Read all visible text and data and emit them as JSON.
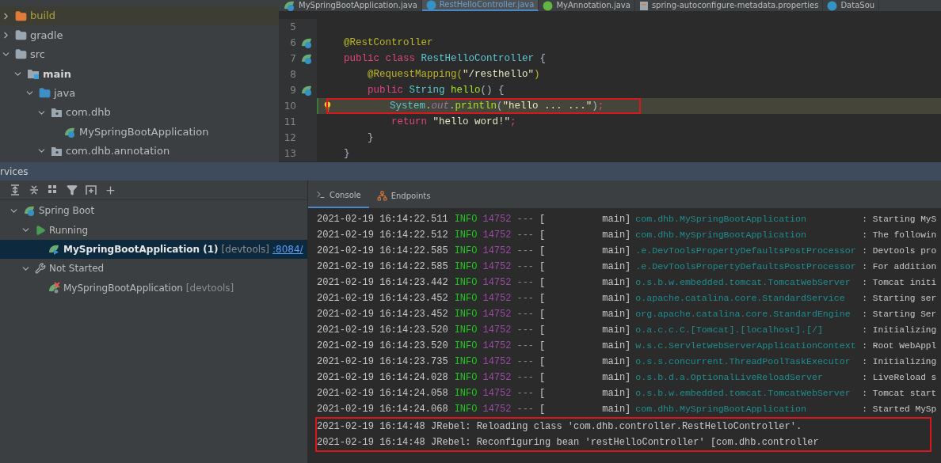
{
  "editor_tabs": [
    {
      "label": "MySpringBootApplication.java",
      "kind": "spring",
      "selected": false
    },
    {
      "label": "RestHelloController.java",
      "kind": "class",
      "selected": true
    },
    {
      "label": "MyAnnotation.java",
      "kind": "annotation",
      "selected": false
    },
    {
      "label": "spring-autoconfigure-metadata.properties",
      "kind": "properties",
      "selected": false
    },
    {
      "label": "DataSou",
      "kind": "class",
      "selected": false
    }
  ],
  "project_tree": [
    {
      "label": "build",
      "kind": "folder-excluded",
      "expanded": false,
      "selected": true
    },
    {
      "label": "gradle",
      "kind": "folder",
      "expanded": false,
      "selected": false
    },
    {
      "label": "src",
      "kind": "folder",
      "expanded": true,
      "selected": false,
      "children": [
        {
          "label": "main",
          "kind": "folder-source",
          "expanded": true,
          "selected": false,
          "children": [
            {
              "label": "java",
              "kind": "folder-java",
              "expanded": true,
              "selected": false,
              "children": [
                {
                  "label": "com.dhb",
                  "kind": "package",
                  "expanded": true,
                  "selected": false,
                  "children": [
                    {
                      "label": "MySpringBootApplication",
                      "kind": "spring",
                      "selected": false
                    }
                  ]
                },
                {
                  "label": "com.dhb.annotation",
                  "kind": "package",
                  "expanded": true,
                  "selected": false
                }
              ]
            }
          ]
        }
      ]
    }
  ],
  "code_lines": [
    {
      "number": "5",
      "kind": "plain",
      "current": false,
      "boxed": false
    },
    {
      "number": "6",
      "kind": "bean",
      "current": false,
      "boxed": false,
      "tokens": [
        {
          "kind": "annotation",
          "text": "@RestController"
        }
      ]
    },
    {
      "number": "7",
      "kind": "bean",
      "current": false,
      "boxed": false,
      "tokens": [
        {
          "kind": "keyword",
          "text": "public class "
        },
        {
          "kind": "type",
          "text": "RestHelloController"
        },
        {
          "kind": "plain",
          "text": " {"
        }
      ]
    },
    {
      "number": "8",
      "kind": "plain",
      "current": false,
      "boxed": false,
      "tokens": [
        {
          "kind": "annotation",
          "text": "    @RequestMapping("
        },
        {
          "kind": "string",
          "text": "\"/resthello\""
        },
        {
          "kind": "annotation",
          "text": ")"
        }
      ]
    },
    {
      "number": "9",
      "kind": "bean",
      "current": false,
      "boxed": false,
      "tokens": [
        {
          "kind": "keyword",
          "text": "    public "
        },
        {
          "kind": "type",
          "text": "String "
        },
        {
          "kind": "method",
          "text": "hello"
        },
        {
          "kind": "plain",
          "text": "() {"
        }
      ]
    },
    {
      "number": "10",
      "kind": "bulb",
      "current": true,
      "boxed": true,
      "tokens": [
        {
          "kind": "type",
          "text": "        System"
        },
        {
          "kind": "plain",
          "text": "."
        },
        {
          "kind": "field",
          "text": "out"
        },
        {
          "kind": "plain",
          "text": "."
        },
        {
          "kind": "method",
          "text": "println"
        },
        {
          "kind": "plain",
          "text": "("
        },
        {
          "kind": "string",
          "text": "\"hello ... ...\""
        },
        {
          "kind": "plain",
          "text": ")"
        },
        {
          "kind": "keyword",
          "text": ";"
        }
      ]
    },
    {
      "number": "11",
      "kind": "plain",
      "current": false,
      "boxed": false,
      "tokens": [
        {
          "kind": "keyword",
          "text": "        return "
        },
        {
          "kind": "string",
          "text": "\"hello word!\""
        },
        {
          "kind": "keyword",
          "text": ";"
        }
      ]
    },
    {
      "number": "12",
      "kind": "plain",
      "current": false,
      "boxed": false,
      "tokens": [
        {
          "kind": "plain",
          "text": "    }"
        }
      ]
    },
    {
      "number": "13",
      "kind": "plain",
      "current": false,
      "boxed": false,
      "tokens": [
        {
          "kind": "plain",
          "text": "}"
        }
      ]
    }
  ],
  "services": {
    "title": "rvices",
    "tree": [
      {
        "label": "Spring Boot",
        "kind": "spring",
        "expanded": true,
        "selected": false,
        "children": [
          {
            "label": "Running",
            "kind": "run",
            "expanded": true,
            "selected": false,
            "children": [
              {
                "label": "MySpringBootApplication (1)",
                "tag": "[devtools]",
                "link": ":8084/",
                "kind": "spring-running",
                "selected": true
              }
            ]
          },
          {
            "label": "Not Started",
            "kind": "wrench",
            "expanded": true,
            "selected": false,
            "children": [
              {
                "label": "MySpringBootApplication",
                "tag": "[devtools]",
                "kind": "spring-stopped",
                "selected": false
              }
            ]
          }
        ]
      }
    ]
  },
  "console_tabs": [
    {
      "label": "Console",
      "kind": "console",
      "selected": true
    },
    {
      "label": "Endpoints",
      "kind": "endpoints",
      "selected": false
    }
  ],
  "log": [
    {
      "kind": "spring",
      "time": "2021-02-19 16:14:22.511",
      "level": "INFO",
      "pid": "14752",
      "sep": "---",
      "thread": "[          main]",
      "logger": "com.dhb.MySpringBootApplication",
      "message": ": Starting MyS"
    },
    {
      "kind": "spring",
      "time": "2021-02-19 16:14:22.512",
      "level": "INFO",
      "pid": "14752",
      "sep": "---",
      "thread": "[          main]",
      "logger": "com.dhb.MySpringBootApplication",
      "message": ": The followin"
    },
    {
      "kind": "spring",
      "time": "2021-02-19 16:14:22.585",
      "level": "INFO",
      "pid": "14752",
      "sep": "---",
      "thread": "[          main]",
      "logger": ".e.DevToolsPropertyDefaultsPostProcessor",
      "message": ": Devtools pro"
    },
    {
      "kind": "spring",
      "time": "2021-02-19 16:14:22.585",
      "level": "INFO",
      "pid": "14752",
      "sep": "---",
      "thread": "[          main]",
      "logger": ".e.DevToolsPropertyDefaultsPostProcessor",
      "message": ": For addition"
    },
    {
      "kind": "spring",
      "time": "2021-02-19 16:14:23.442",
      "level": "INFO",
      "pid": "14752",
      "sep": "---",
      "thread": "[          main]",
      "logger": "o.s.b.w.embedded.tomcat.TomcatWebServer",
      "message": ": Tomcat initi"
    },
    {
      "kind": "spring",
      "time": "2021-02-19 16:14:23.452",
      "level": "INFO",
      "pid": "14752",
      "sep": "---",
      "thread": "[          main]",
      "logger": "o.apache.catalina.core.StandardService",
      "message": ": Starting ser"
    },
    {
      "kind": "spring",
      "time": "2021-02-19 16:14:23.452",
      "level": "INFO",
      "pid": "14752",
      "sep": "---",
      "thread": "[          main]",
      "logger": "org.apache.catalina.core.StandardEngine",
      "message": ": Starting Ser"
    },
    {
      "kind": "spring",
      "time": "2021-02-19 16:14:23.520",
      "level": "INFO",
      "pid": "14752",
      "sep": "---",
      "thread": "[          main]",
      "logger": "o.a.c.c.C.[Tomcat].[localhost].[/]",
      "message": ": Initializing"
    },
    {
      "kind": "spring",
      "time": "2021-02-19 16:14:23.520",
      "level": "INFO",
      "pid": "14752",
      "sep": "---",
      "thread": "[          main]",
      "logger": "w.s.c.ServletWebServerApplicationContext",
      "message": ": Root WebAppl"
    },
    {
      "kind": "spring",
      "time": "2021-02-19 16:14:23.735",
      "level": "INFO",
      "pid": "14752",
      "sep": "---",
      "thread": "[          main]",
      "logger": "o.s.s.concurrent.ThreadPoolTaskExecutor",
      "message": ": Initializing"
    },
    {
      "kind": "spring",
      "time": "2021-02-19 16:14:24.028",
      "level": "INFO",
      "pid": "14752",
      "sep": "---",
      "thread": "[          main]",
      "logger": "o.s.b.d.a.OptionalLiveReloadServer",
      "message": ": LiveReload s"
    },
    {
      "kind": "spring",
      "time": "2021-02-19 16:14:24.058",
      "level": "INFO",
      "pid": "14752",
      "sep": "---",
      "thread": "[          main]",
      "logger": "o.s.b.w.embedded.tomcat.TomcatWebServer",
      "message": ": Tomcat start"
    },
    {
      "kind": "spring",
      "time": "2021-02-19 16:14:24.068",
      "level": "INFO",
      "pid": "14752",
      "sep": "---",
      "thread": "[          main]",
      "logger": "com.dhb.MySpringBootApplication",
      "message": ": Started MySp"
    }
  ],
  "jrebel_log": {
    "boxed": true,
    "lines": [
      "2021-02-19 16:14:48 JRebel: Reloading class 'com.dhb.controller.RestHelloController'.",
      "2021-02-19 16:14:48 JRebel: Reconfiguring bean 'restHelloController' [com.dhb.controller"
    ]
  }
}
